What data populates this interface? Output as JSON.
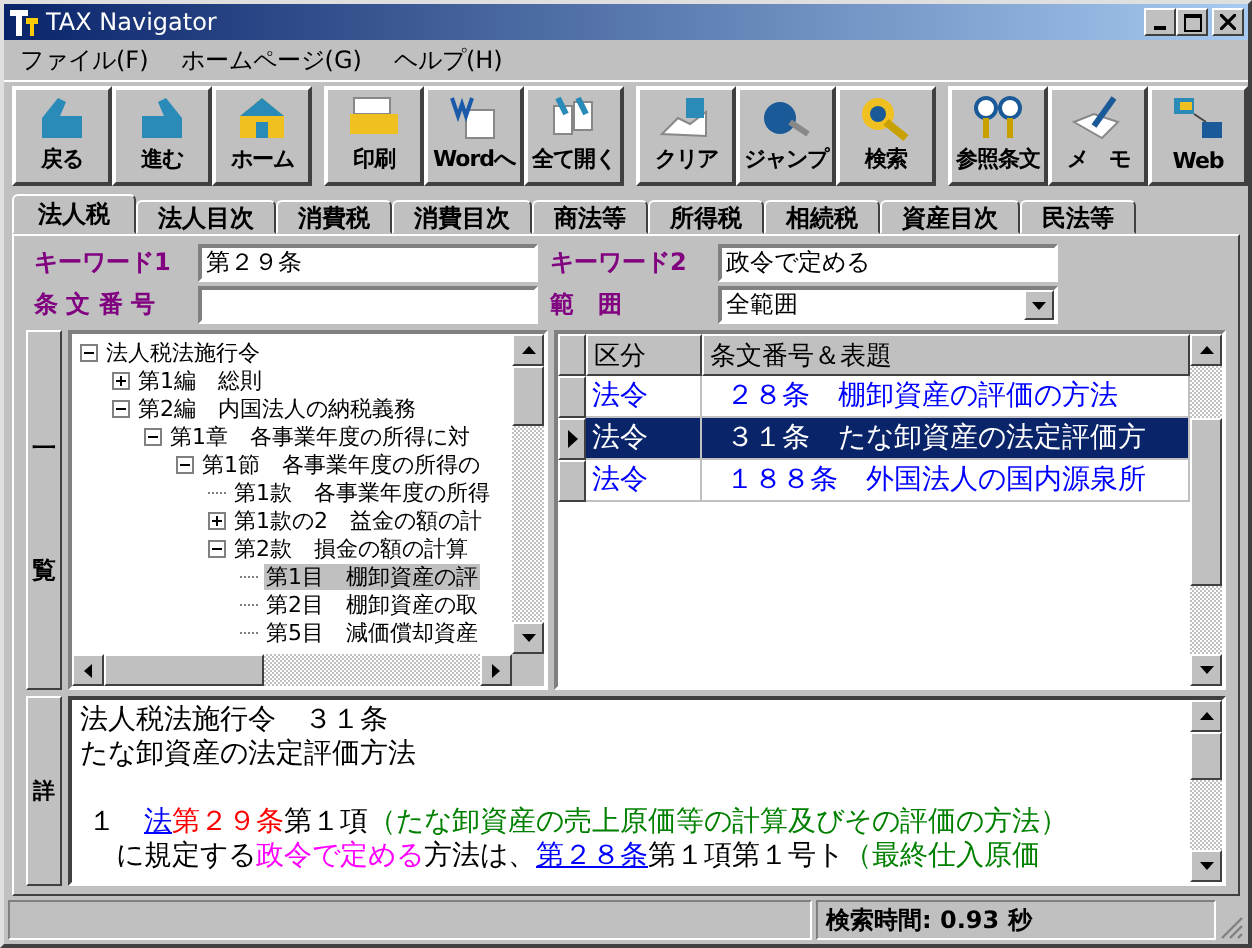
{
  "window": {
    "title": "TAX Navigator"
  },
  "menu": [
    "ファイル(F)",
    "ホームページ(G)",
    "ヘルプ(H)"
  ],
  "toolbar": [
    {
      "buttons": [
        "戻る",
        "進む",
        "ホーム"
      ]
    },
    {
      "buttons": [
        "印刷",
        "Wordへ",
        "全て開く"
      ]
    },
    {
      "buttons": [
        "クリア",
        "ジャンプ",
        "検索"
      ]
    },
    {
      "buttons": [
        "参照条文",
        "メ　モ",
        "Web"
      ]
    }
  ],
  "tabs": [
    {
      "label": "法人税",
      "selected": true
    },
    {
      "label": "法人目次",
      "selected": false
    },
    {
      "label": "消費税",
      "selected": false
    },
    {
      "label": "消費目次",
      "selected": false
    },
    {
      "label": "商法等",
      "selected": false
    },
    {
      "label": "所得税",
      "selected": false
    },
    {
      "label": "相続税",
      "selected": false
    },
    {
      "label": "資産目次",
      "selected": false
    },
    {
      "label": "民法等",
      "selected": false
    }
  ],
  "search": {
    "keyword1": {
      "label": "キーワード1",
      "value": "第２９条"
    },
    "keyword2": {
      "label": "キーワード2",
      "value": "政令で定める"
    },
    "article_number": {
      "label": "条 文 番 号"
    },
    "scope": {
      "label": "範　囲",
      "value": "全範囲"
    }
  },
  "tree": {
    "side_label": [
      "一",
      "覧"
    ],
    "nodes": [
      {
        "label": "法人税法施行令",
        "expanded": true,
        "selected": false,
        "children": [
          {
            "label": "第1編　総則",
            "expanded": false,
            "selected": false
          },
          {
            "label": "第2編　内国法人の納税義務",
            "expanded": true,
            "selected": false,
            "children": [
              {
                "label": "第1章　各事業年度の所得に対",
                "expanded": true,
                "selected": false,
                "children": [
                  {
                    "label": "第1節　各事業年度の所得の",
                    "expanded": true,
                    "selected": false,
                    "children": [
                      {
                        "label": "第1款　各事業年度の所得",
                        "selected": false
                      },
                      {
                        "label": "第1款の2　益金の額の計",
                        "expanded": false,
                        "selected": false
                      },
                      {
                        "label": "第2款　損金の額の計算",
                        "expanded": true,
                        "selected": false,
                        "children": [
                          {
                            "label": "第1目　棚卸資産の評",
                            "selected": true
                          },
                          {
                            "label": "第2目　棚卸資産の取",
                            "selected": false
                          },
                          {
                            "label": "第5目　減価償却資産",
                            "selected": false
                          }
                        ]
                      }
                    ]
                  }
                ]
              }
            ]
          }
        ]
      }
    ]
  },
  "table": {
    "columns": [
      "区分",
      "条文番号＆表題"
    ],
    "rows": [
      {
        "category": "法令",
        "article": "２８条　棚卸資産の評価の方法",
        "selected": false
      },
      {
        "category": "法令",
        "article": "３１条　たな卸資産の法定評価方",
        "selected": true
      },
      {
        "category": "法令",
        "article": "１８８条　外国法人の国内源泉所",
        "selected": false
      }
    ]
  },
  "detail": {
    "side_label": "詳",
    "heading": [
      "法人税法施行令　３１条",
      "たな卸資産の法定評価方法"
    ],
    "lines": [
      [
        {
          "kind": "plain",
          "text": "１　"
        },
        {
          "kind": "link",
          "text": "法"
        },
        {
          "kind": "hit",
          "text": "第２９条"
        },
        {
          "kind": "plain",
          "text": "第１項"
        },
        {
          "kind": "note",
          "text": "（たな卸資産の売上原価等の計算及びその評価の方法）"
        }
      ],
      [
        {
          "kind": "plain",
          "text": "に規定する"
        },
        {
          "kind": "keyword",
          "text": "政令で定める"
        },
        {
          "kind": "plain",
          "text": "方法は、"
        },
        {
          "kind": "link",
          "text": "第２８条"
        },
        {
          "kind": "plain",
          "text": "第１項第１号ト"
        },
        {
          "kind": "note",
          "text": "（最終仕入原価"
        }
      ]
    ]
  },
  "status_bar": {
    "search_time": "検索時間: 0.93 秒"
  }
}
